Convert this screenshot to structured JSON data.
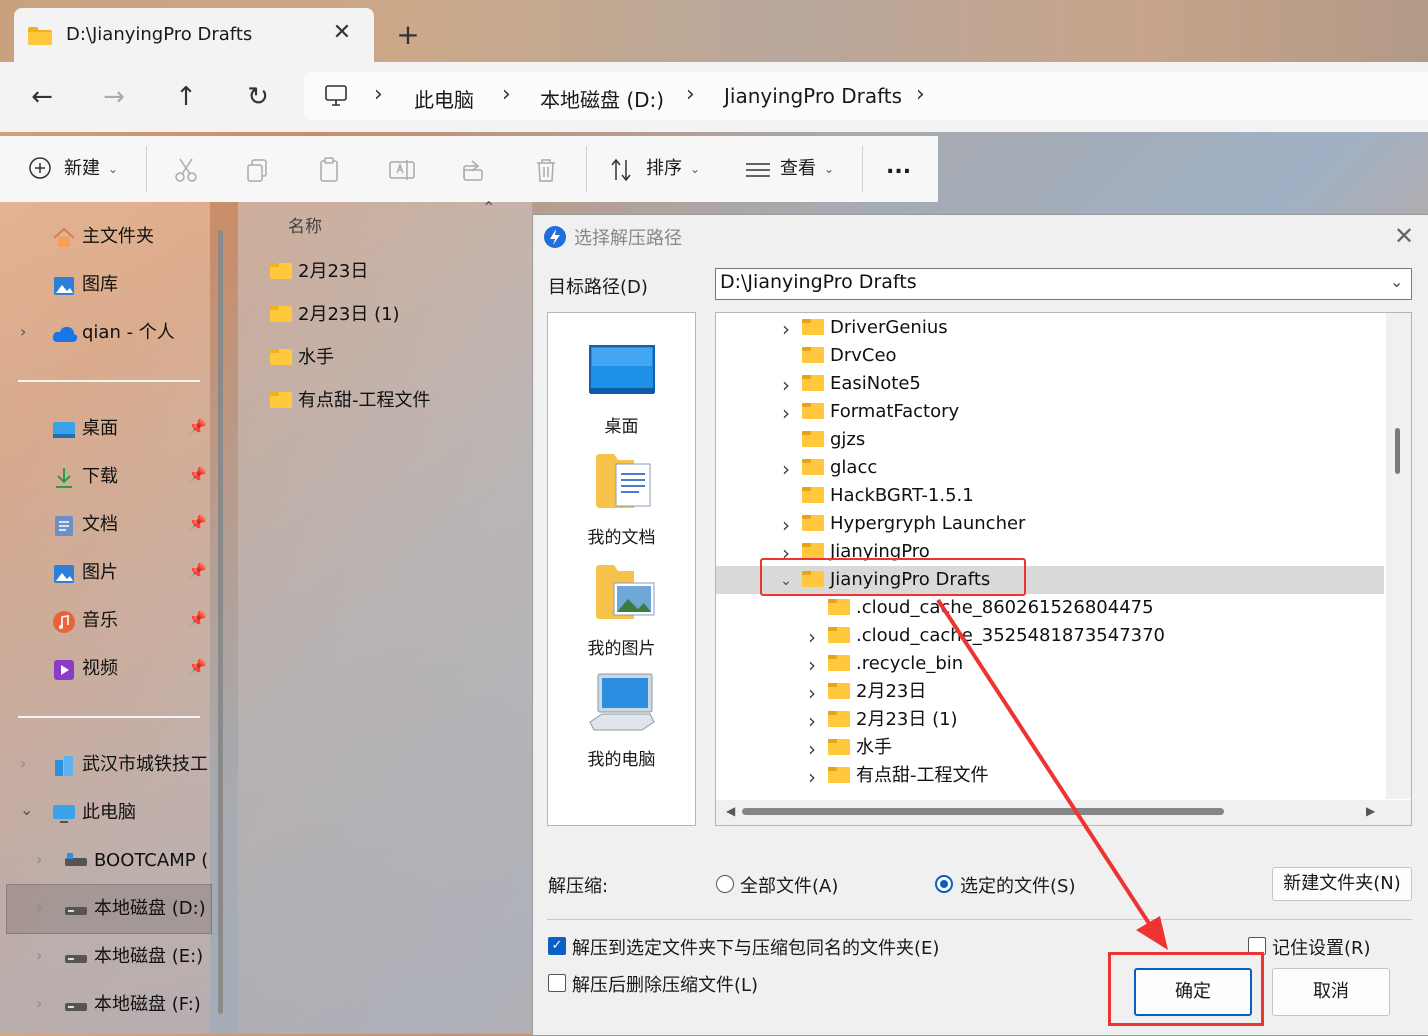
{
  "window": {
    "tab_title": "D:\\JianyingPro Drafts",
    "breadcrumb": [
      "此电脑",
      "本地磁盘 (D:)",
      "JianyingPro Drafts"
    ]
  },
  "toolbar": {
    "new_label": "新建",
    "sort_label": "排序",
    "view_label": "查看",
    "more_label": "..."
  },
  "sidebar": {
    "items": [
      {
        "label": "主文件夹"
      },
      {
        "label": "图库"
      },
      {
        "label": "qian - 个人"
      },
      {
        "label": "桌面"
      },
      {
        "label": "下载"
      },
      {
        "label": "文档"
      },
      {
        "label": "图片"
      },
      {
        "label": "音乐"
      },
      {
        "label": "视频"
      },
      {
        "label": "武汉市城铁技工"
      },
      {
        "label": "此电脑"
      },
      {
        "label": "BOOTCAMP ("
      },
      {
        "label": "本地磁盘 (D:)"
      },
      {
        "label": "本地磁盘 (E:)"
      },
      {
        "label": "本地磁盘 (F:)"
      }
    ]
  },
  "files": {
    "column_name": "名称",
    "items": [
      "2月23日",
      "2月23日 (1)",
      "水手",
      "有点甜-工程文件"
    ]
  },
  "dialog": {
    "title": "选择解压路径",
    "target_label": "目标路径(D)",
    "target_value": "D:\\JianyingPro Drafts",
    "places": [
      "桌面",
      "我的文档",
      "我的图片",
      "我的电脑"
    ],
    "tree": [
      {
        "label": "DriverGenius",
        "level": 0,
        "expander": "collapsed"
      },
      {
        "label": "DrvCeo",
        "level": 0,
        "expander": "none"
      },
      {
        "label": "EasiNote5",
        "level": 0,
        "expander": "collapsed"
      },
      {
        "label": "FormatFactory",
        "level": 0,
        "expander": "collapsed"
      },
      {
        "label": "gjzs",
        "level": 0,
        "expander": "none"
      },
      {
        "label": "glacc",
        "level": 0,
        "expander": "collapsed"
      },
      {
        "label": "HackBGRT-1.5.1",
        "level": 0,
        "expander": "none"
      },
      {
        "label": "Hypergryph Launcher",
        "level": 0,
        "expander": "collapsed"
      },
      {
        "label": "JianyingPro",
        "level": 0,
        "expander": "collapsed"
      },
      {
        "label": "JianyingPro Drafts",
        "level": 0,
        "expander": "expanded",
        "selected": true
      },
      {
        "label": ".cloud_cache_860261526804475",
        "level": 1,
        "expander": "none"
      },
      {
        "label": ".cloud_cache_3525481873547370",
        "level": 1,
        "expander": "collapsed"
      },
      {
        "label": ".recycle_bin",
        "level": 1,
        "expander": "collapsed"
      },
      {
        "label": "2月23日",
        "level": 1,
        "expander": "collapsed"
      },
      {
        "label": "2月23日 (1)",
        "level": 1,
        "expander": "collapsed"
      },
      {
        "label": "水手",
        "level": 1,
        "expander": "collapsed"
      },
      {
        "label": "有点甜-工程文件",
        "level": 1,
        "expander": "collapsed"
      }
    ],
    "extract_label": "解压缩:",
    "radio_all": "全部文件(A)",
    "radio_selected": "选定的文件(S)",
    "new_folder_button": "新建文件夹(N)",
    "check_same_name": "解压到选定文件夹下与压缩包同名的文件夹(E)",
    "check_delete": "解压后删除压缩文件(L)",
    "check_remember": "记住设置(R)",
    "ok_button": "确定",
    "cancel_button": "取消"
  },
  "colors": {
    "accent": "#0a5fc4",
    "highlight": "#ee3333"
  }
}
